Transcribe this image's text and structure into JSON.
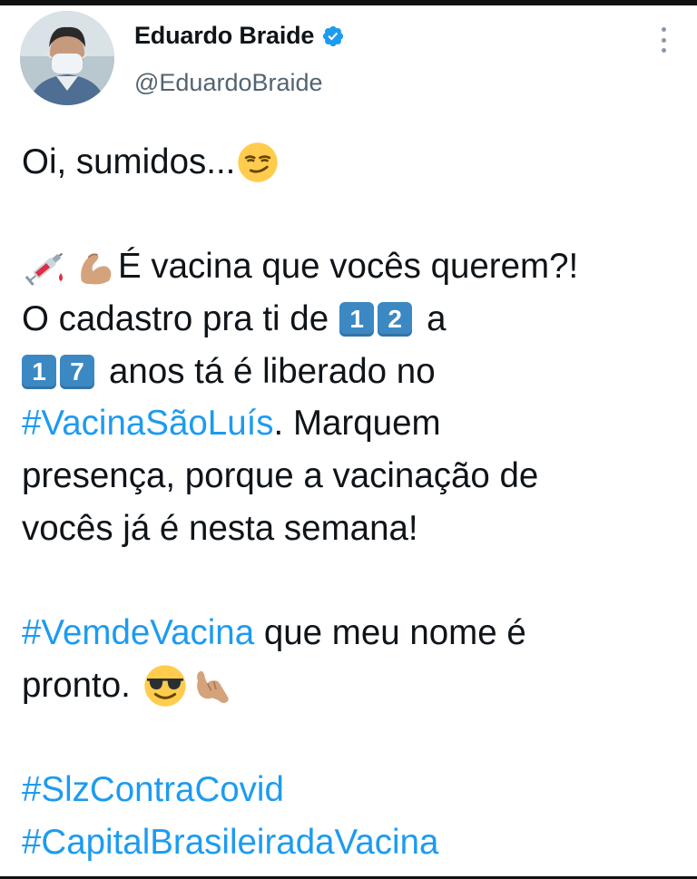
{
  "tweet": {
    "author": {
      "display_name": "Eduardo Braide",
      "handle": "@EduardoBraide",
      "verified": true
    },
    "lines": {
      "l1": "Oi, sumidos...",
      "l2": "É vacina que vocês querem?!",
      "l3a": "O cadastro pra ti de",
      "keycap1": "1",
      "keycap2": "2",
      "l3b": "a",
      "keycap3": "1",
      "keycap4": "7",
      "l4": "anos tá é liberado no",
      "hashtag1": "#VacinaSãoLuís",
      "l5": ". Marquem",
      "l6": "presença, porque a vacinação de",
      "l7": "vocês já é nesta semana!",
      "hashtag2": "#VemdeVacina",
      "l8": " que meu nome é",
      "l9": "pronto.",
      "hashtag3": "#SlzContraCovid",
      "hashtag4": "#CapitalBrasileiradaVacina"
    },
    "emojis": [
      "smirking-face",
      "syringe",
      "drop-of-blood",
      "flexed-biceps",
      "smiling-face-with-sunglasses",
      "call-me-hand"
    ]
  },
  "colors": {
    "text": "#0f1419",
    "secondary": "#536471",
    "hashtag": "#1d9bf0",
    "verified": "#1d9bf0"
  }
}
